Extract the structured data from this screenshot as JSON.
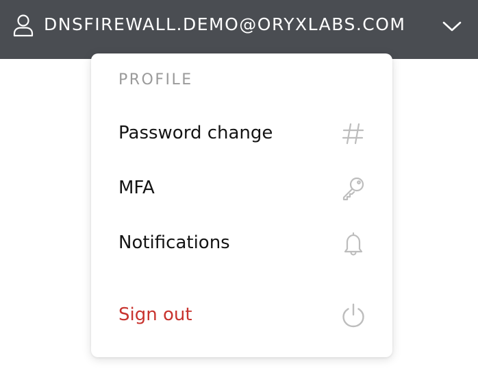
{
  "header": {
    "account_email": "DNSFIREWALL.DEMO@ORYXLABS.COM",
    "user_icon": "user-icon",
    "dropdown_icon": "chevron-down-icon",
    "background_color": "#4a4d52"
  },
  "menu": {
    "section_title": "PROFILE",
    "items": [
      {
        "label": "Password change",
        "icon": "hash-icon"
      },
      {
        "label": "MFA",
        "icon": "key-icon"
      },
      {
        "label": "Notifications",
        "icon": "bell-icon"
      }
    ],
    "sign_out": {
      "label": "Sign out",
      "icon": "power-icon",
      "color": "#c8332e"
    }
  }
}
